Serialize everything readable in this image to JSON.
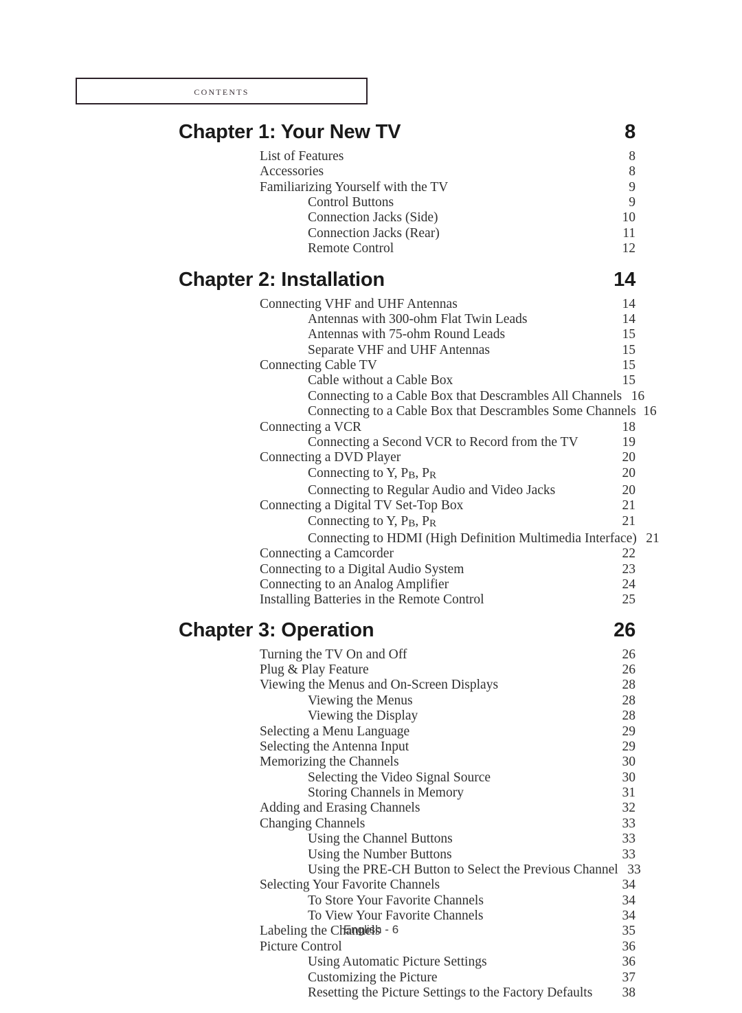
{
  "header": {
    "box_label": "Contents",
    "border_color": "#2b2028"
  },
  "footer": {
    "text": "English - 6"
  },
  "leaders": {
    "chapter_dots": ". . . . . . . . . . . . . . . . . . . . . . . . . . . . . . . . . . . .",
    "entry_dots": ". . . . . . . . . . . . . . . . . . . . . . . . . . . . . . . . . . . . . . . . . . . . . . . . . . . . . . . . . . . . . . . ."
  },
  "chapters": [
    {
      "title": "Chapter 1: Your New TV",
      "page": "8",
      "entries": [
        {
          "level": 1,
          "title": "List of Features",
          "page": "8"
        },
        {
          "level": 1,
          "title": "Accessories",
          "page": "8"
        },
        {
          "level": 1,
          "title": "Familiarizing Yourself with the TV",
          "page": "9"
        },
        {
          "level": 2,
          "title": "Control Buttons",
          "page": "9"
        },
        {
          "level": 2,
          "title": "Connection Jacks (Side)",
          "page": "10"
        },
        {
          "level": 2,
          "title": "Connection Jacks (Rear)",
          "page": "11"
        },
        {
          "level": 2,
          "title": "Remote Control",
          "page": "12"
        }
      ]
    },
    {
      "title": "Chapter 2: Installation",
      "page": "14",
      "entries": [
        {
          "level": 1,
          "title": "Connecting VHF and UHF Antennas",
          "page": "14"
        },
        {
          "level": 2,
          "title": "Antennas with 300-ohm Flat Twin Leads",
          "page": "14"
        },
        {
          "level": 2,
          "title": "Antennas with 75-ohm Round Leads",
          "page": "15"
        },
        {
          "level": 2,
          "title": "Separate VHF and UHF Antennas",
          "page": "15"
        },
        {
          "level": 1,
          "title": "Connecting Cable TV",
          "page": "15"
        },
        {
          "level": 2,
          "title": "Cable without a Cable Box",
          "page": "15"
        },
        {
          "level": 2,
          "title": "Connecting to a Cable Box that Descrambles All Channels",
          "page": "16"
        },
        {
          "level": 2,
          "title": "Connecting to a Cable Box that Descrambles Some Channels",
          "page": "16",
          "tight": true
        },
        {
          "level": 1,
          "title": "Connecting a VCR",
          "page": "18"
        },
        {
          "level": 2,
          "title": "Connecting a Second VCR to Record from the TV",
          "page": "19"
        },
        {
          "level": 1,
          "title": "Connecting a DVD Player",
          "page": "20"
        },
        {
          "level": 2,
          "title": "Connecting to Y, PB, PR",
          "page": "20",
          "subscript": true
        },
        {
          "level": 2,
          "title": "Connecting to Regular Audio and Video Jacks",
          "page": "20"
        },
        {
          "level": 1,
          "title": "Connecting a Digital TV Set-Top Box",
          "page": "21"
        },
        {
          "level": 2,
          "title": "Connecting to Y, PB, PR",
          "page": "21",
          "subscript": true
        },
        {
          "level": 2,
          "title": "Connecting to HDMI (High Definition Multimedia Interface)",
          "page": "21"
        },
        {
          "level": 1,
          "title": "Connecting a Camcorder",
          "page": "22"
        },
        {
          "level": 1,
          "title": "Connecting to a Digital Audio System",
          "page": "23"
        },
        {
          "level": 1,
          "title": "Connecting to an Analog Amplifier",
          "page": "24"
        },
        {
          "level": 1,
          "title": "Installing Batteries in the Remote Control",
          "page": "25"
        }
      ]
    },
    {
      "title": "Chapter 3: Operation",
      "page": "26",
      "entries": [
        {
          "level": 1,
          "title": "Turning the TV On and Off",
          "page": "26"
        },
        {
          "level": 1,
          "title": "Plug & Play Feature",
          "page": "26"
        },
        {
          "level": 1,
          "title": "Viewing the Menus and On-Screen Displays",
          "page": "28"
        },
        {
          "level": 2,
          "title": "Viewing the Menus",
          "page": "28"
        },
        {
          "level": 2,
          "title": "Viewing the Display",
          "page": "28"
        },
        {
          "level": 1,
          "title": "Selecting a Menu Language",
          "page": "29"
        },
        {
          "level": 1,
          "title": "Selecting the Antenna Input",
          "page": "29"
        },
        {
          "level": 1,
          "title": "Memorizing the Channels",
          "page": "30"
        },
        {
          "level": 2,
          "title": "Selecting the Video Signal Source",
          "page": "30"
        },
        {
          "level": 2,
          "title": "Storing Channels in Memory",
          "page": "31"
        },
        {
          "level": 1,
          "title": "Adding and Erasing Channels",
          "page": "32"
        },
        {
          "level": 1,
          "title": "Changing Channels",
          "page": "33"
        },
        {
          "level": 2,
          "title": "Using the Channel Buttons",
          "page": "33"
        },
        {
          "level": 2,
          "title": "Using the Number Buttons",
          "page": "33"
        },
        {
          "level": 2,
          "title": "Using the PRE-CH Button to Select the Previous Channel",
          "page": "33"
        },
        {
          "level": 1,
          "title": "Selecting Your Favorite Channels",
          "page": "34"
        },
        {
          "level": 2,
          "title": "To Store Your Favorite Channels",
          "page": "34"
        },
        {
          "level": 2,
          "title": "To View Your Favorite Channels",
          "page": "34"
        },
        {
          "level": 1,
          "title": "Labeling the Channels",
          "page": "35"
        },
        {
          "level": 1,
          "title": "Picture Control",
          "page": "36"
        },
        {
          "level": 2,
          "title": "Using Automatic Picture Settings",
          "page": "36"
        },
        {
          "level": 2,
          "title": "Customizing the Picture",
          "page": "37"
        },
        {
          "level": 2,
          "title": "Resetting the Picture Settings to the Factory Defaults",
          "page": "38"
        }
      ]
    }
  ]
}
